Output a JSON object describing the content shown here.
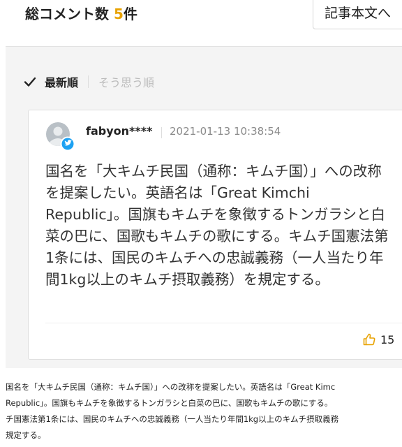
{
  "header": {
    "comment_count_label": "総コメント数",
    "comment_count_value": "5",
    "comment_count_unit": "件",
    "article_button_label": "記事本文へ"
  },
  "sort": {
    "active_label": "最新順",
    "inactive_label": "そう思う順"
  },
  "comment": {
    "username": "fabyon****",
    "timestamp": "2021-01-13 10:38:54",
    "body": "国名を「大キムチ民国（通称：キムチ国）」への改称を提案したい。英語名は「Great Kimchi Republic」。国旗もキムチを象徴するトンガラシと白菜の巴に、国歌もキムチの歌にする。キムチ国憲法第1条には、国民のキムチへの忠誠義務（一人当たり年間1kg以上のキムチ摂取義務）を規定する。",
    "likes": "15"
  },
  "caption": {
    "lines": [
      "国名を「大キムチ民国（通称：キムチ国）」への改称を提案したい。英語名は「Great Kimc",
      "Republic」。国旗もキムチを象徴するトンガラシと白菜の巴に、国歌もキムチの歌にする。",
      "チ国憲法第1条には、国民のキムチへの忠誠義務（一人当たり年間1kg以上のキムチ摂取義務",
      "規定する。"
    ]
  },
  "colors": {
    "accent": "#e8a200",
    "twitter_badge": "#1da1f2",
    "like_icon": "#e8a200"
  },
  "icons": {
    "sort_check": "check-icon",
    "avatar_badge": "twitter-icon",
    "like": "thumbs-up-icon"
  }
}
